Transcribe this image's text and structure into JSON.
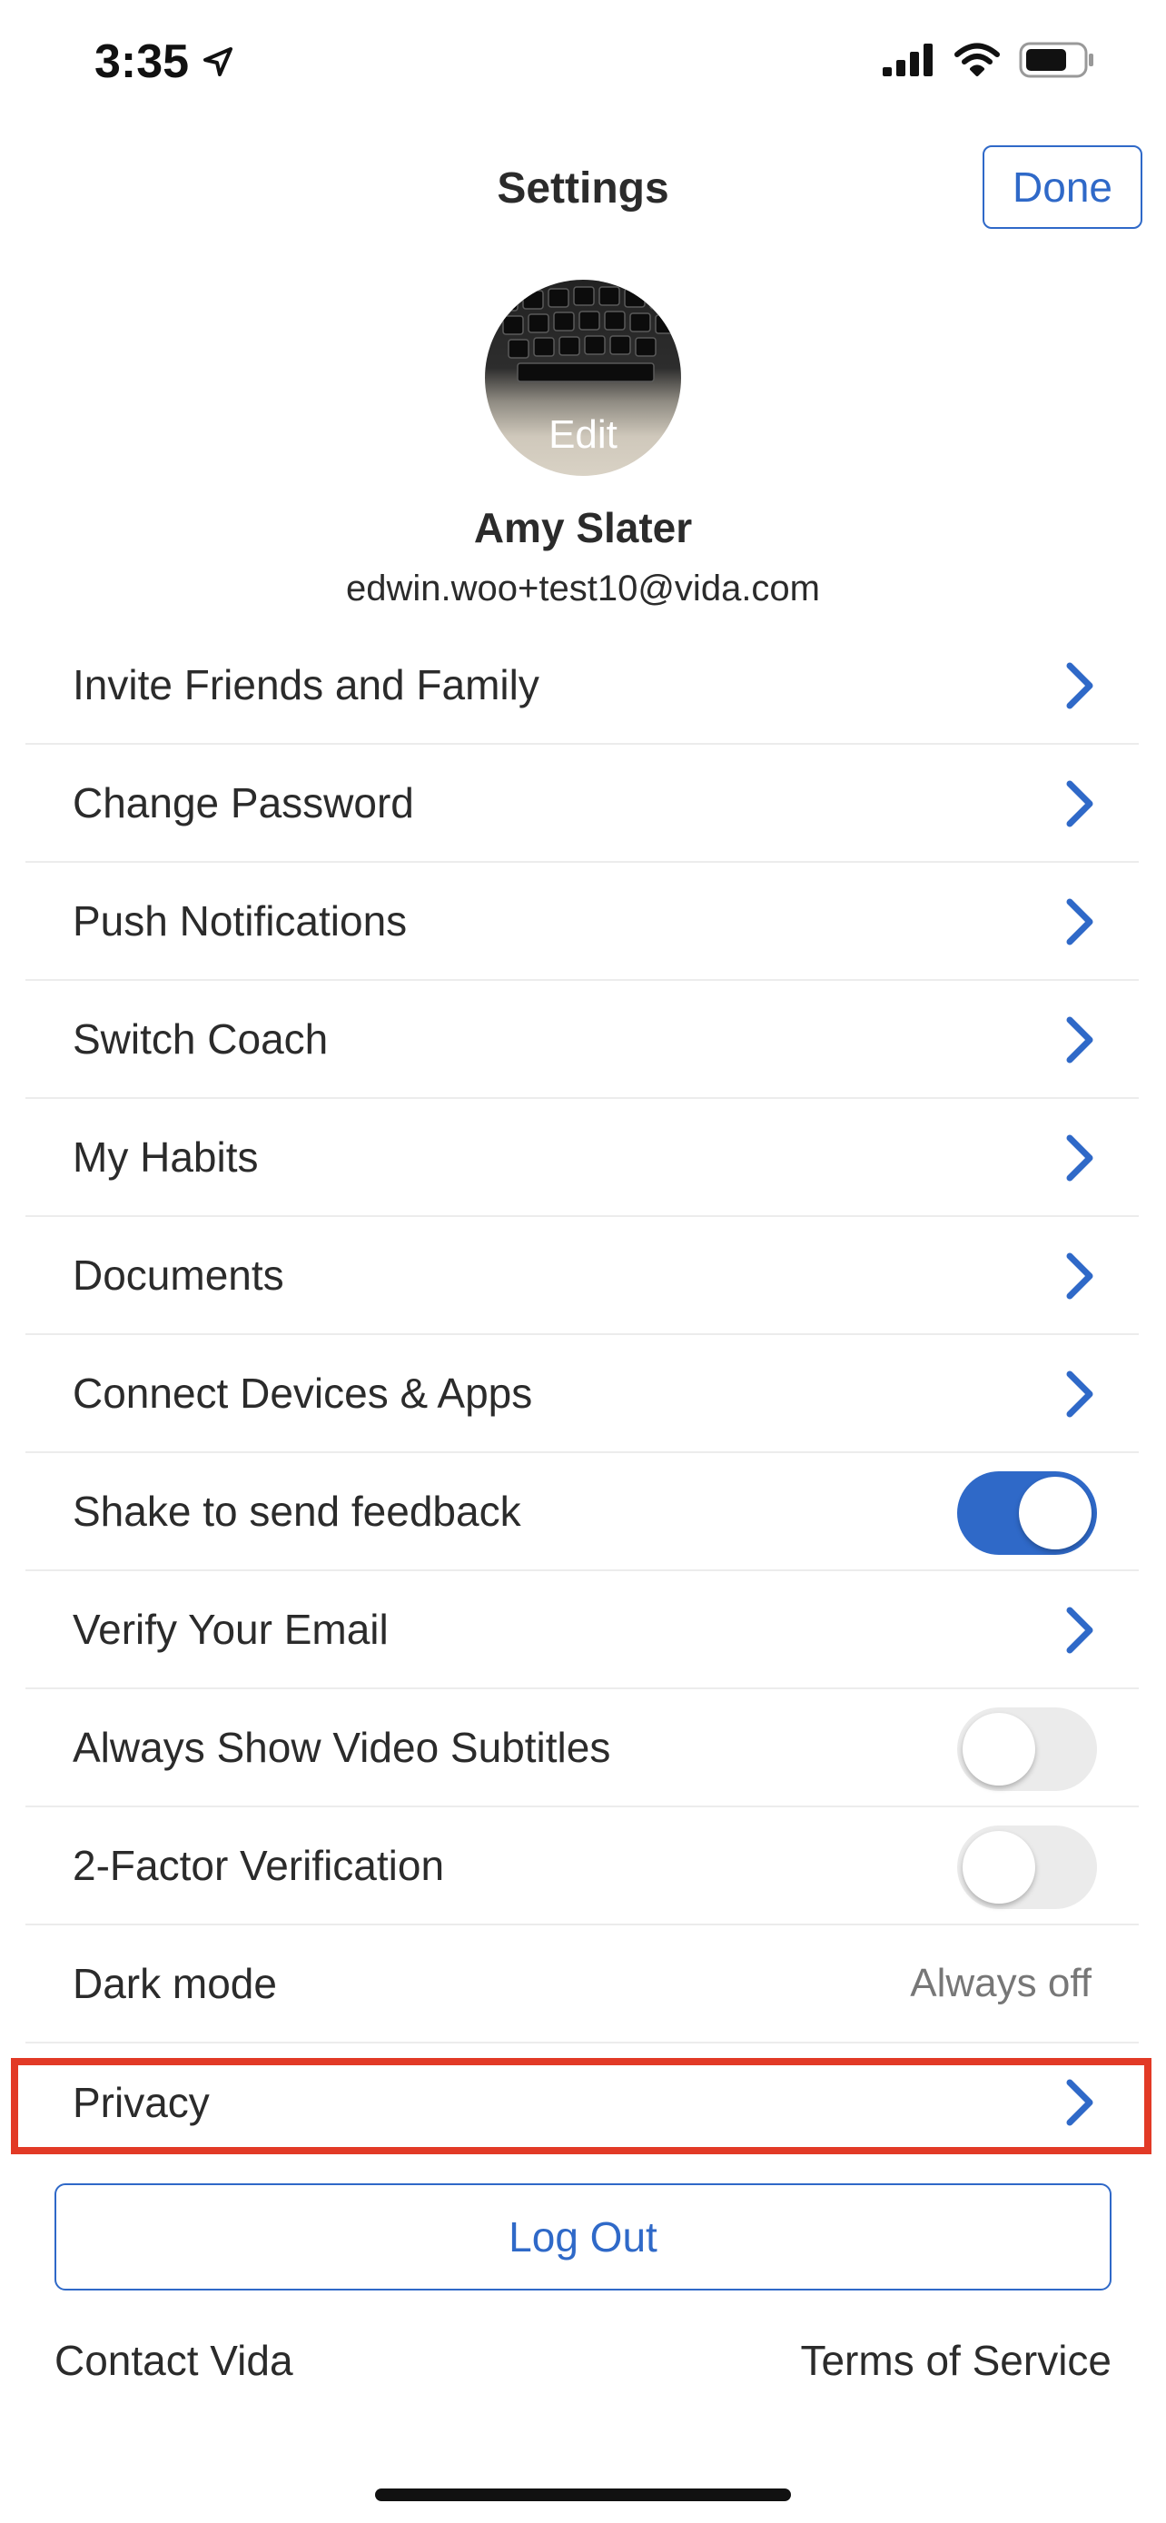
{
  "status_bar": {
    "time": "3:35",
    "icons": [
      "location-arrow-icon",
      "cellular-signal-icon",
      "wifi-icon",
      "battery-icon"
    ]
  },
  "header": {
    "title": "Settings",
    "done_label": "Done"
  },
  "profile": {
    "avatar_edit_label": "Edit",
    "name": "Amy Slater",
    "email": "edwin.woo+test10@vida.com"
  },
  "settings": {
    "items": [
      {
        "label": "Invite Friends and Family",
        "control": "chevron"
      },
      {
        "label": "Change Password",
        "control": "chevron"
      },
      {
        "label": "Push Notifications",
        "control": "chevron"
      },
      {
        "label": "Switch Coach",
        "control": "chevron"
      },
      {
        "label": "My Habits",
        "control": "chevron"
      },
      {
        "label": "Documents",
        "control": "chevron"
      },
      {
        "label": "Connect Devices & Apps",
        "control": "chevron"
      },
      {
        "label": "Shake to send feedback",
        "control": "toggle",
        "toggle_on": true
      },
      {
        "label": "Verify Your Email",
        "control": "chevron"
      },
      {
        "label": "Always Show Video Subtitles",
        "control": "toggle",
        "toggle_on": false
      },
      {
        "label": "2-Factor Verification",
        "control": "toggle",
        "toggle_on": false
      },
      {
        "label": "Dark mode",
        "control": "value",
        "value": "Always off"
      },
      {
        "label": "Privacy",
        "control": "chevron",
        "highlighted": true
      }
    ]
  },
  "logout_label": "Log Out",
  "footer": {
    "contact_label": "Contact Vida",
    "terms_label": "Terms of Service"
  },
  "colors": {
    "accent": "#2f69c8",
    "highlight": "#e23a26",
    "text": "#2b2b2b",
    "toggle_off": "#ebebeb"
  }
}
